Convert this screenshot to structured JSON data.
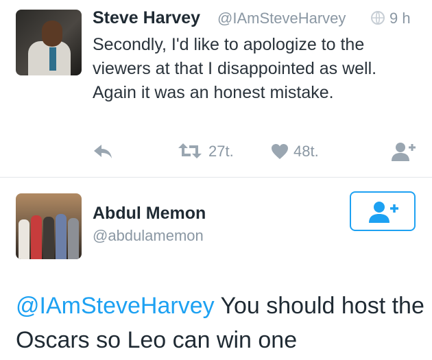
{
  "tweet1": {
    "name": "Steve Harvey",
    "handle": "@IAmSteveHarvey",
    "time": "9 h",
    "text": "Secondly, I'd like to apologize to the viewers at that I disappointed as well. Again it was an honest mistake.",
    "retweets": "27t.",
    "likes": "48t.",
    "icons": [
      "reply-icon",
      "retweet-icon",
      "heart-icon",
      "follow-icon",
      "globe-icon"
    ]
  },
  "tweet2": {
    "name": "Abdul Memon",
    "handle": "@abdulamemon",
    "mention": "@IAmSteveHarvey",
    "text": " You should host the Oscars so Leo can win one"
  },
  "colors": {
    "accent": "#1da1f2",
    "muted": "#8a97a3",
    "text": "#1f2a33"
  }
}
